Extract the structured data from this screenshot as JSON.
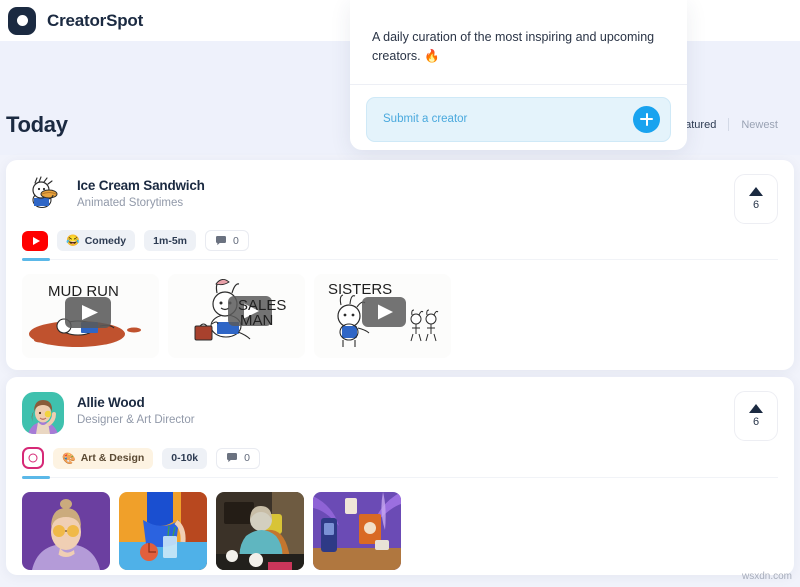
{
  "brand": {
    "name": "CreatorSpot",
    "logo_icon": "circle-dot-logo"
  },
  "hero": {
    "section_title": "Today"
  },
  "filters": {
    "tabs": [
      {
        "label": "Featured",
        "active": true
      },
      {
        "label": "Newest",
        "active": false
      }
    ]
  },
  "submit_card": {
    "description": "A daily curation of the most inspiring and upcoming creators.",
    "description_emoji": "🔥",
    "input_placeholder": "Submit a creator",
    "input_value": "",
    "add_button_icon": "plus-icon",
    "accent_color": "#19a3ef",
    "field_background": "#e4f3fb"
  },
  "creators": [
    {
      "name": "Ice Cream Sandwich",
      "role": "Animated Storytimes",
      "avatar_icon": "ice-cream-sandwich-avatar",
      "platform": "youtube",
      "platform_icon": "youtube-icon",
      "category": "Comedy",
      "category_emoji": "😂",
      "metric": "1m-5m",
      "comments": "0",
      "comment_icon": "comment-bubble-icon",
      "votes": "6",
      "vote_icon": "caret-up-icon",
      "thumbnails": [
        {
          "title": "MUD RUN",
          "alt": "mud-run-thumbnail"
        },
        {
          "title": "SALES MAN",
          "alt": "sales-man-thumbnail"
        },
        {
          "title": "SISTERS",
          "alt": "sisters-thumbnail"
        }
      ]
    },
    {
      "name": "Allie Wood",
      "role": "Designer & Art Director",
      "avatar_icon": "allie-wood-avatar",
      "platform": "instagram",
      "platform_icon": "instagram-icon",
      "category": "Art & Design",
      "category_emoji": "🎨",
      "metric": "0-10k",
      "comments": "0",
      "comment_icon": "comment-bubble-icon",
      "votes": "6",
      "vote_icon": "caret-up-icon",
      "thumbnails": [
        {
          "title": "",
          "alt": "portrait-sunglasses-thumbnail"
        },
        {
          "title": "",
          "alt": "blue-dress-still-life-thumbnail"
        },
        {
          "title": "",
          "alt": "workspace-coffee-thumbnail"
        },
        {
          "title": "",
          "alt": "product-palms-thumbnail"
        }
      ]
    }
  ],
  "watermark": "wsxdn.com"
}
